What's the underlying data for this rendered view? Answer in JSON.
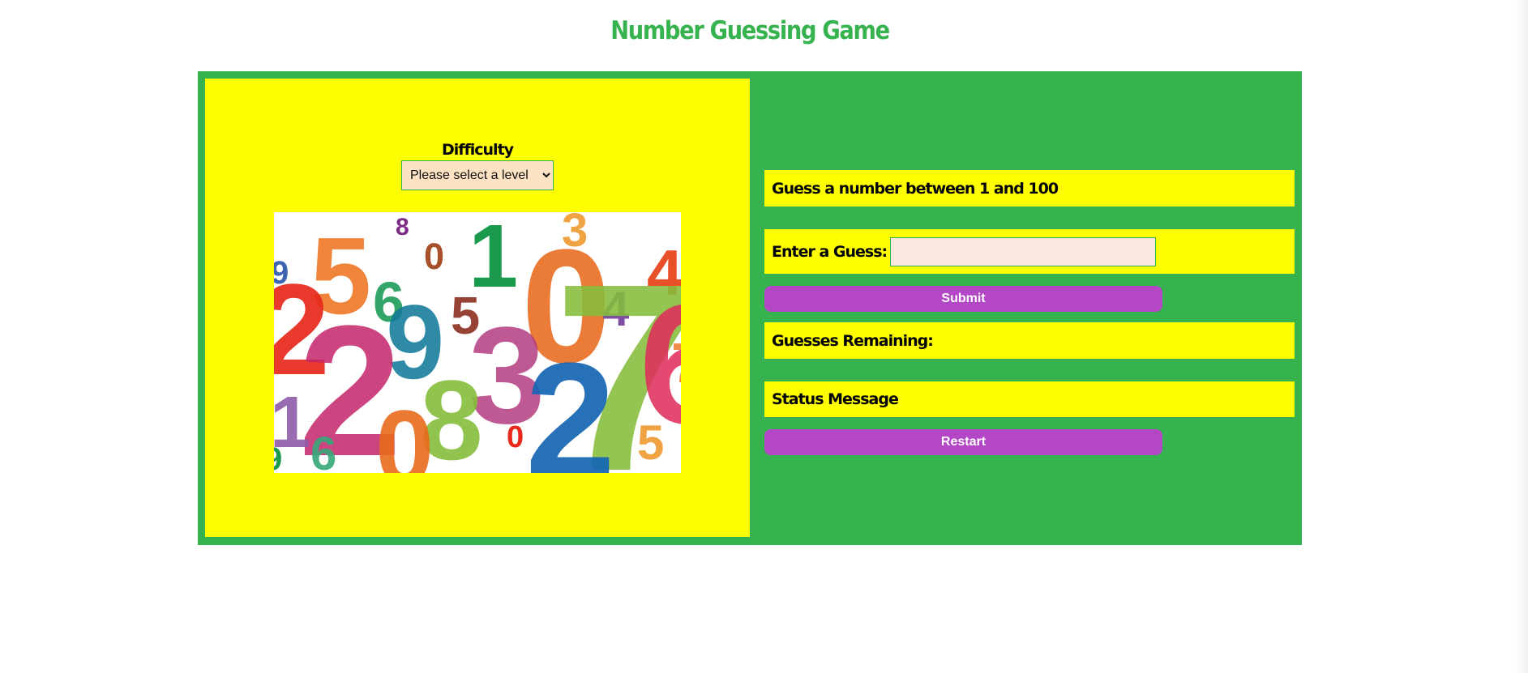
{
  "page": {
    "title": "Number Guessing Game"
  },
  "left": {
    "difficulty_label": "Difficulty",
    "level_select": {
      "selected": "Please select a level",
      "options": [
        "Please select a level"
      ]
    },
    "image_glyphs": [
      "8",
      "3",
      "1",
      "0",
      "5",
      "9",
      "4",
      "6",
      "5",
      "0",
      "2",
      "9",
      "2",
      "3",
      "4",
      "7",
      "6",
      "1",
      "8",
      "0",
      "2",
      "9",
      "6",
      "5",
      "0",
      "7"
    ]
  },
  "right": {
    "range_text": "Guess a number between 1 and 100",
    "guess_label": "Enter a Guess:",
    "guess_value": "",
    "submit_label": "Submit",
    "remaining_label": "Guesses Remaining:",
    "status_label": "Status Message",
    "restart_label": "Restart"
  },
  "colors": {
    "frame": "#36b34f",
    "panel": "#ffff00",
    "button": "#b347c6",
    "title": "#36b34f"
  }
}
